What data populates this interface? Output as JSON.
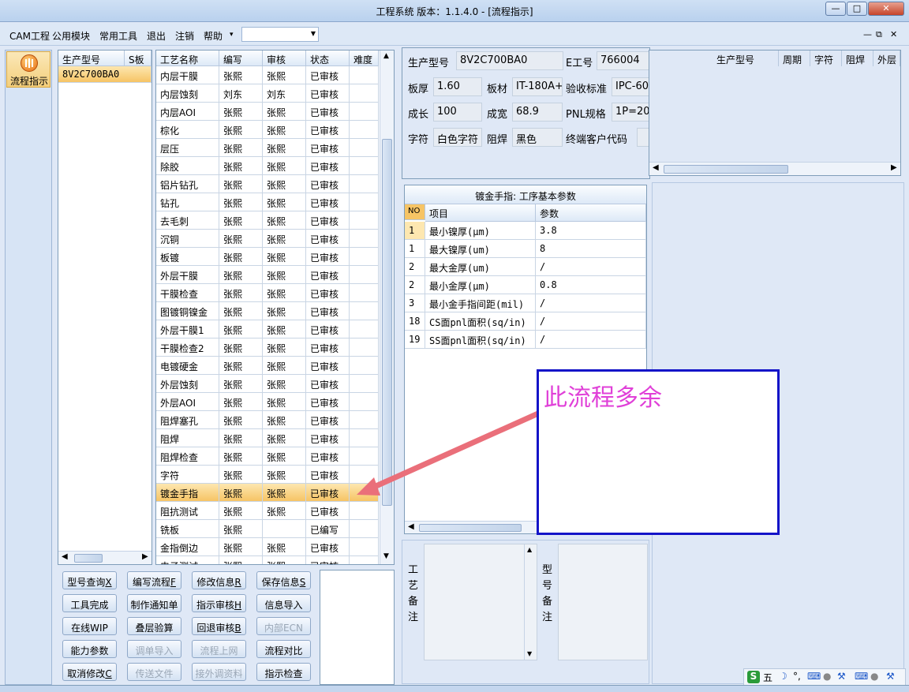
{
  "window": {
    "title": "工程系统   版本：1.1.4.0 - [流程指示]",
    "min": "—",
    "max": "□",
    "close": "✕"
  },
  "menu": {
    "items": [
      "CAM工程",
      "公用模块",
      "常用工具",
      "退出",
      "注销",
      "帮助"
    ],
    "help_arrow": "▾",
    "combo_value": "",
    "mdi": [
      "—",
      "⧉",
      "✕"
    ]
  },
  "nav": {
    "label": "流程指示"
  },
  "model_list": {
    "headers": [
      "生产型号",
      "S板"
    ],
    "rows": [
      [
        "8V2C700BA0",
        ""
      ]
    ]
  },
  "process": {
    "headers": [
      "工艺名称",
      "编写",
      "审核",
      "状态",
      "难度"
    ],
    "rows": [
      [
        "内层干膜",
        "张熙",
        "张熙",
        "已审核"
      ],
      [
        "内层蚀刻",
        "刘东",
        "刘东",
        "已审核"
      ],
      [
        "内层AOI",
        "张熙",
        "张熙",
        "已审核"
      ],
      [
        "棕化",
        "张熙",
        "张熙",
        "已审核"
      ],
      [
        "层压",
        "张熙",
        "张熙",
        "已审核"
      ],
      [
        "除胶",
        "张熙",
        "张熙",
        "已审核"
      ],
      [
        "铝片钻孔",
        "张熙",
        "张熙",
        "已审核"
      ],
      [
        "钻孔",
        "张熙",
        "张熙",
        "已审核"
      ],
      [
        "去毛刺",
        "张熙",
        "张熙",
        "已审核"
      ],
      [
        "沉铜",
        "张熙",
        "张熙",
        "已审核"
      ],
      [
        "板镀",
        "张熙",
        "张熙",
        "已审核"
      ],
      [
        "外层干膜",
        "张熙",
        "张熙",
        "已审核"
      ],
      [
        "干膜检查",
        "张熙",
        "张熙",
        "已审核"
      ],
      [
        "图镀铜镍金",
        "张熙",
        "张熙",
        "已审核"
      ],
      [
        "外层干膜1",
        "张熙",
        "张熙",
        "已审核"
      ],
      [
        "干膜检查2",
        "张熙",
        "张熙",
        "已审核"
      ],
      [
        "电镀硬金",
        "张熙",
        "张熙",
        "已审核"
      ],
      [
        "外层蚀刻",
        "张熙",
        "张熙",
        "已审核"
      ],
      [
        "外层AOI",
        "张熙",
        "张熙",
        "已审核"
      ],
      [
        "阻焊塞孔",
        "张熙",
        "张熙",
        "已审核"
      ],
      [
        "阻焊",
        "张熙",
        "张熙",
        "已审核"
      ],
      [
        "阻焊检查",
        "张熙",
        "张熙",
        "已审核"
      ],
      [
        "字符",
        "张熙",
        "张熙",
        "已审核"
      ],
      [
        "镀金手指",
        "张熙",
        "张熙",
        "已审核"
      ],
      [
        "阻抗测试",
        "张熙",
        "张熙",
        "已审核"
      ],
      [
        "铣板",
        "张熙",
        "",
        "已编写"
      ],
      [
        "金指倒边",
        "张熙",
        "张熙",
        "已审核"
      ],
      [
        "电子测试",
        "张熙",
        "张熙",
        "已审核"
      ]
    ],
    "selected_index": 23
  },
  "buttons": [
    {
      "label": "型号查询",
      "key": "X",
      "enabled": true
    },
    {
      "label": "编写流程",
      "key": "F",
      "enabled": true
    },
    {
      "label": "修改信息",
      "key": "R",
      "enabled": true
    },
    {
      "label": "保存信息",
      "key": "S",
      "enabled": true
    },
    {
      "label": "工具完成",
      "key": "",
      "enabled": true
    },
    {
      "label": "制作通知单",
      "key": "",
      "enabled": true
    },
    {
      "label": "指示审核",
      "key": "H",
      "enabled": true
    },
    {
      "label": "信息导入",
      "key": "",
      "enabled": true
    },
    {
      "label": "在线WIP",
      "key": "",
      "enabled": true
    },
    {
      "label": "叠层验算",
      "key": "",
      "enabled": true
    },
    {
      "label": "回退审核",
      "key": "B",
      "enabled": true
    },
    {
      "label": "内部ECN",
      "key": "",
      "enabled": false
    },
    {
      "label": "能力参数",
      "key": "",
      "enabled": true
    },
    {
      "label": "调单导入",
      "key": "",
      "enabled": false
    },
    {
      "label": "流程上网",
      "key": "",
      "enabled": false
    },
    {
      "label": "流程对比",
      "key": "",
      "enabled": true
    },
    {
      "label": "取消修改",
      "key": "C",
      "enabled": true
    },
    {
      "label": "传送文件",
      "key": "",
      "enabled": false
    },
    {
      "label": "接外调资料",
      "key": "",
      "enabled": false
    },
    {
      "label": "指示检查",
      "key": "",
      "enabled": true
    }
  ],
  "info": {
    "model_label": "生产型号",
    "model_value": "8V2C700BA0",
    "eno_label": "E工号",
    "eno_value": "766004",
    "thickness_label": "板厚",
    "thickness_value": "1.60",
    "material_label": "板材",
    "material_value": "IT-180A+",
    "standard_label": "验收标准",
    "standard_value": "IPC-60",
    "length_label": "成长",
    "length_value": "100",
    "width_label": "成宽",
    "width_value": "68.9",
    "pnl_label": "PNL规格",
    "pnl_value": "1P=20",
    "silk_label": "字符",
    "silk_value": "白色字符",
    "mask_label": "阻焊",
    "mask_value": "黑色",
    "customer_label": "终端客户代码",
    "customer_value": ""
  },
  "cross_grid": {
    "headers": [
      "生产型号",
      "周期",
      "字符",
      "阻焊",
      "外层"
    ]
  },
  "params": {
    "title": "镀金手指: 工序基本参数",
    "headers": [
      "NO",
      "项目",
      "参数"
    ],
    "rows": [
      [
        "1",
        "最小镍厚(μm)",
        "3.8"
      ],
      [
        "1",
        "最大镍厚(um)",
        "8"
      ],
      [
        "2",
        "最大金厚(um)",
        "/"
      ],
      [
        "2",
        "最小金厚(μm)",
        "0.8"
      ],
      [
        "3",
        "最小金手指间距(mil)",
        "/"
      ],
      [
        "18",
        "CS面pnl面积(sq/in)",
        "/"
      ],
      [
        "19",
        "SS面pnl面积(sq/in)",
        "/"
      ]
    ]
  },
  "remarks": {
    "process_label": [
      "工",
      "艺",
      "备",
      "注"
    ],
    "model_label": [
      "型",
      "号",
      "备",
      "注"
    ]
  },
  "annotation": {
    "text": "此流程多余",
    "color": "#e040d8",
    "arrow_color": "#ea6f7a",
    "border_color": "#1414c8"
  },
  "ime": {
    "items": [
      "S",
      "五",
      "☽",
      "°,",
      "⌨",
      "●",
      "⚒",
      "⌨",
      "●",
      "⚒"
    ]
  }
}
